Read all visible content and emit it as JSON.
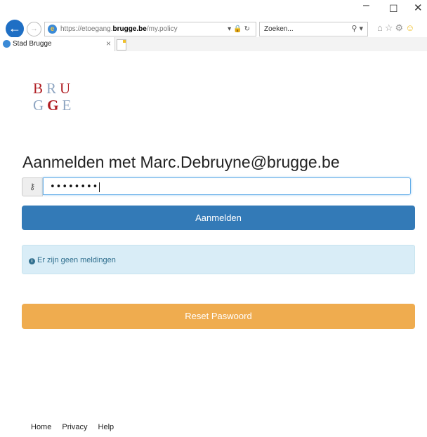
{
  "window": {
    "minimize_glyph": "–",
    "maximize_glyph": "☐",
    "close_glyph": "✕"
  },
  "browser": {
    "url_prefix": "https://etoegang.",
    "url_domain": "brugge.be",
    "url_path": "/my.policy",
    "search_placeholder": "Zoeken...",
    "tab_title": "Stad Brugge"
  },
  "logo": {
    "line1": [
      "B",
      "R",
      "U"
    ],
    "line2": [
      "G",
      "G",
      "E"
    ]
  },
  "main": {
    "heading": "Aanmelden met Marc.Debruyne@brugge.be",
    "password_value": "••••••••",
    "login_label": "Aanmelden",
    "alert_text": "Er zijn geen meldingen",
    "reset_label": "Reset Paswoord"
  },
  "footer": {
    "links": [
      "Home",
      "Privacy",
      "Help"
    ]
  },
  "colors": {
    "primary": "#337ab7",
    "warning": "#efac4f",
    "info_bg": "#d9edf7",
    "logo_red": "#b01e23",
    "logo_blue": "#8ea5c1"
  }
}
